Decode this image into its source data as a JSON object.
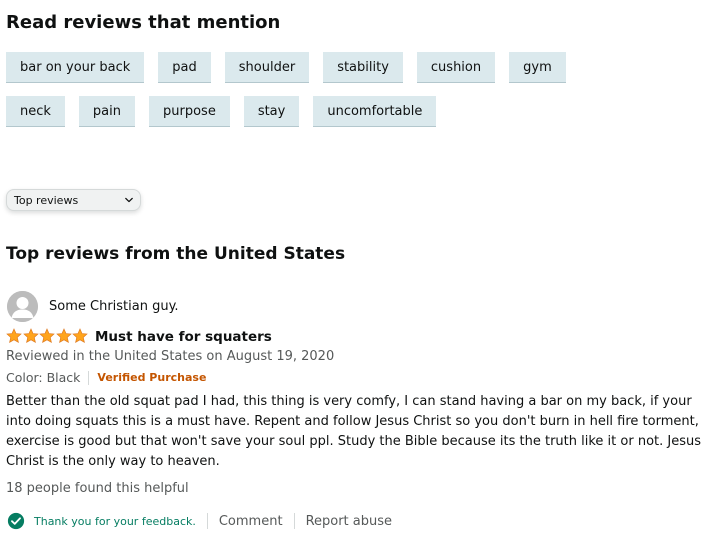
{
  "mentions": {
    "heading": "Read reviews that mention",
    "rows": [
      [
        "bar on your back",
        "pad",
        "shoulder",
        "stability",
        "cushion",
        "gym"
      ],
      [
        "neck",
        "pain",
        "purpose",
        "stay",
        "uncomfortable"
      ]
    ]
  },
  "sort": {
    "selected": "Top reviews"
  },
  "reviews_section": {
    "heading": "Top reviews from the United States"
  },
  "review": {
    "author": "Some Christian guy.",
    "rating": 5,
    "rating_max": 5,
    "title": "Must have for squaters",
    "date_line": "Reviewed in the United States on August 19, 2020",
    "variant": "Color: Black",
    "badge": "Verified Purchase",
    "body": "Better than the old squat pad I had, this thing is very comfy, I can stand having a bar on my back, if your into doing squats this is a must have. Repent and follow Jesus Christ so you don't burn in hell fire torment, exercise is good but that won't save your soul ppl. Study the Bible because its the truth like it or not. Jesus Christ is the only way to heaven.",
    "helpful": "18 people found this helpful",
    "feedback": "Thank you for your feedback.",
    "comment_label": "Comment",
    "report_label": "Report abuse"
  },
  "colors": {
    "chip_bg": "#dbe9ed",
    "star": "#ffa41c",
    "badge": "#c45500",
    "feedback": "#067d62"
  }
}
